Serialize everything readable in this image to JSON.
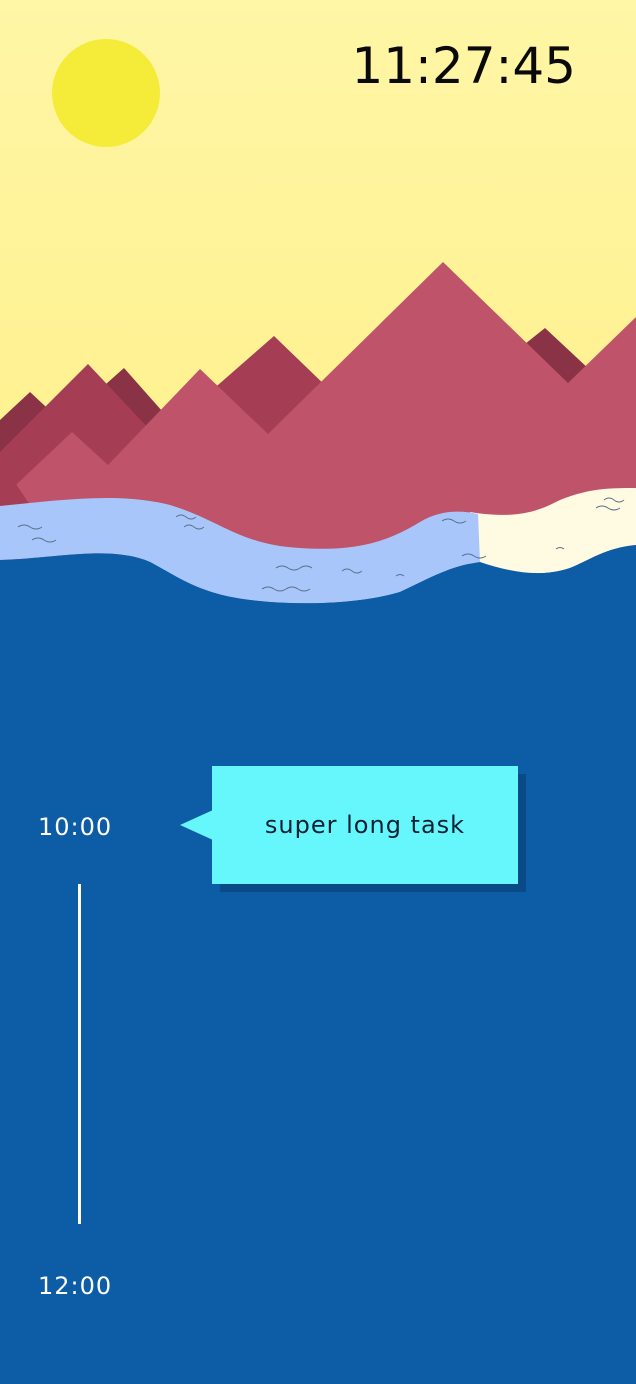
{
  "clock": {
    "time": "11:27:45"
  },
  "timeline": {
    "start_label": "10:00",
    "end_label": "12:00"
  },
  "task": {
    "title": "super long task"
  },
  "colors": {
    "sky": "#fff39a",
    "sun": "#f4ec38",
    "mountain_dark": "#8a3347",
    "mountain_mid": "#a53e55",
    "mountain_front": "#bf5369",
    "river": "#a9c6fb",
    "sand": "#fffbe2",
    "water": "#0d5ca6",
    "task_card": "#66f7fd",
    "task_shadow": "#0a4a86"
  },
  "icons": {
    "sun": "sun-icon"
  }
}
